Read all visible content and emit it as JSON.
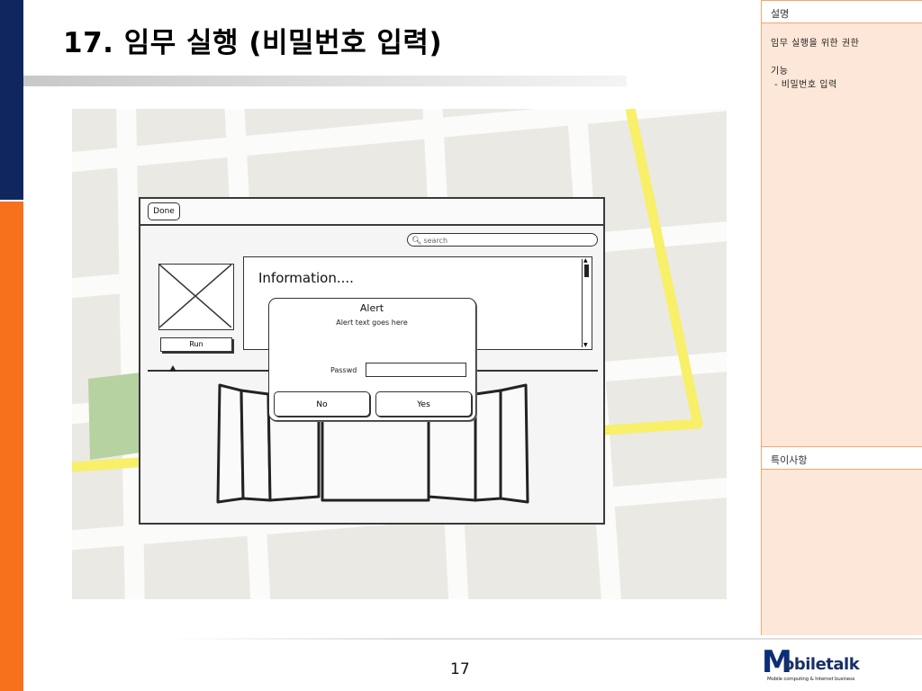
{
  "slide": {
    "title": "17. 임무 실행 (비밀번호 입력)",
    "page_number": "17"
  },
  "notes_panel": {
    "description_header": "설명",
    "description_line1": "임무 실행을 위한 권한",
    "description_line2": "기능",
    "description_line3": "- 비밀번호 입력",
    "special_notes_header": "특이사항"
  },
  "mockup": {
    "done_label": "Done",
    "search_placeholder": "search",
    "run_label": "Run",
    "info_title": "Information....",
    "alert": {
      "title": "Alert",
      "text": "Alert text goes here",
      "password_label": "Passwd",
      "password_value": "",
      "no_label": "No",
      "yes_label": "Yes"
    }
  },
  "logo": {
    "initial": "M",
    "wordmark": "obiletalk",
    "tagline": "Mobile computing & Internet business"
  },
  "colors": {
    "sidebar_blue": "#10265e",
    "sidebar_orange": "#f7711c",
    "notes_bg": "#fde7d8",
    "map_road_yellow": "#f7f068"
  }
}
